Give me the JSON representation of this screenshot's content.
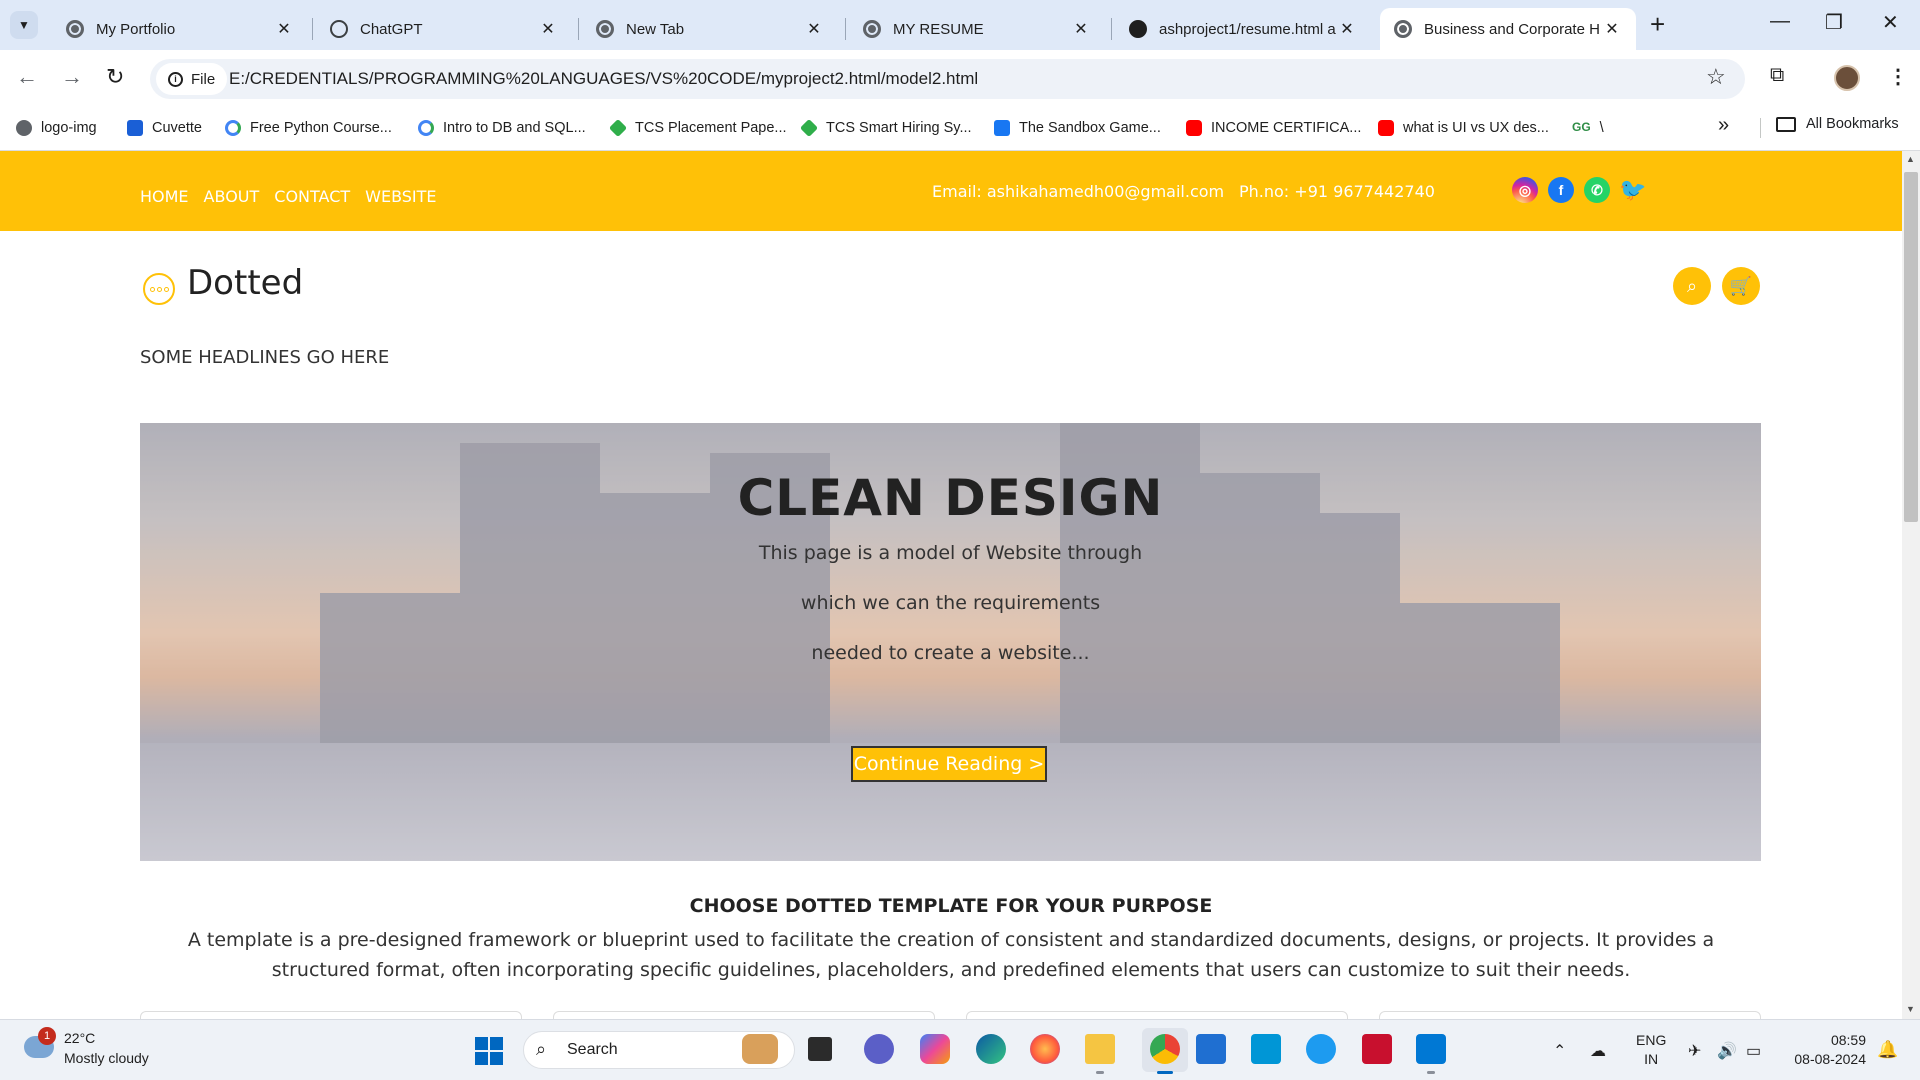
{
  "browser": {
    "tabs": [
      {
        "label": "My Portfolio",
        "icon": "globe-icon"
      },
      {
        "label": "ChatGPT",
        "icon": "chatgpt-icon"
      },
      {
        "label": "New Tab",
        "icon": "chrome-icon"
      },
      {
        "label": "MY RESUME",
        "icon": "globe-icon"
      },
      {
        "label": "ashproject1/resume.html a",
        "icon": "github-icon"
      },
      {
        "label": "Business and Corporate H",
        "icon": "globe-icon",
        "active": true
      }
    ],
    "address_chip": "File",
    "url": "E:/CREDENTIALS/PROGRAMMING%20LANGUAGES/VS%20CODE/myproject2.html/model2.html",
    "bookmarks": [
      {
        "label": "logo-img",
        "icon": "globe-icon"
      },
      {
        "label": "Cuvette",
        "icon": "cuvette-icon"
      },
      {
        "label": "Free Python Course...",
        "icon": "google-icon"
      },
      {
        "label": "Intro to DB and SQL...",
        "icon": "google-icon"
      },
      {
        "label": "TCS Placement Pape...",
        "icon": "tcs-icon"
      },
      {
        "label": "TCS Smart Hiring Sy...",
        "icon": "tcs-icon"
      },
      {
        "label": "The Sandbox Game...",
        "icon": "sandbox-icon"
      },
      {
        "label": "INCOME CERTIFICA...",
        "icon": "youtube-icon"
      },
      {
        "label": "what is UI vs UX des...",
        "icon": "youtube-icon"
      },
      {
        "label": "\\",
        "icon": "gfg-icon"
      }
    ],
    "all_bookmarks": "All Bookmarks"
  },
  "site": {
    "nav": [
      "HOME",
      "ABOUT",
      "CONTACT",
      "WEBSITE"
    ],
    "email": "Email: ashikahamedh00@gmail.com",
    "phone": "Ph.no: +91 9677442740",
    "social": [
      "instagram-icon",
      "facebook-icon",
      "whatsapp-icon",
      "twitter-icon"
    ],
    "brand": "Dotted",
    "headlines": "SOME HEADLINES GO HERE",
    "hero": {
      "title": "CLEAN DESIGN",
      "line1": "This page is a model of Website through",
      "line2": "which we can the requirements",
      "line3": "needed to create a website...",
      "button": "Continue Reading >"
    },
    "section": {
      "title": "CHOOSE DOTTED TEMPLATE FOR YOUR PURPOSE",
      "desc": "A template is a pre-designed framework or blueprint used to facilitate the creation of consistent and standardized documents, designs, or projects. It provides a structured format, often incorporating specific guidelines, placeholders, and predefined elements that users can customize to suit their needs."
    },
    "accent_color": "#ffc107"
  },
  "taskbar": {
    "weather_temp": "22°C",
    "weather_desc": "Mostly cloudy",
    "weather_badge": "1",
    "search": "Search",
    "lang1": "ENG",
    "lang2": "IN",
    "time": "08:59",
    "date": "08-08-2024"
  }
}
